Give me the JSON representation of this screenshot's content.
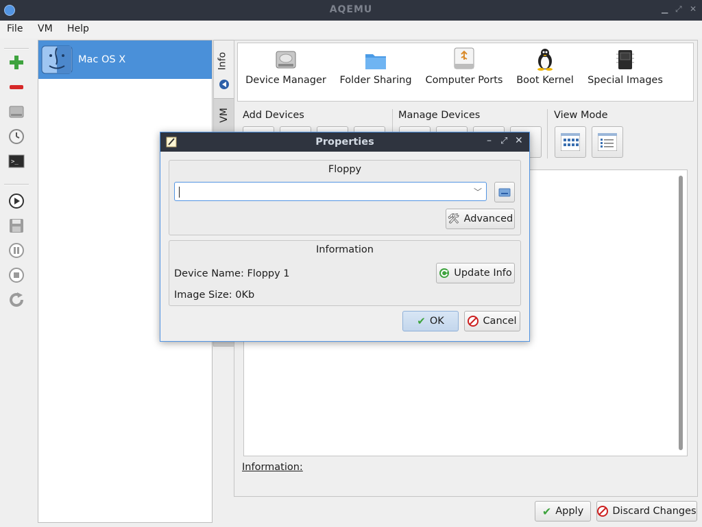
{
  "window": {
    "title": "AQEMU"
  },
  "menu": [
    "File",
    "VM",
    "Help"
  ],
  "vm_list": {
    "items": [
      {
        "name": "Mac OS X"
      }
    ]
  },
  "tabs": {
    "info": "Info",
    "vm": "VM"
  },
  "top_buttons": [
    "Device Manager",
    "Folder Sharing",
    "Computer Ports",
    "Boot Kernel",
    "Special Images"
  ],
  "groups": {
    "add_devices": "Add Devices",
    "manage_devices": "Manage Devices",
    "view_mode": "View Mode"
  },
  "information_label": "Information:",
  "footer": {
    "apply": "Apply",
    "discard": "Discard Changes"
  },
  "dialog": {
    "title": "Properties",
    "floppy_group": "Floppy",
    "floppy_value": "",
    "advanced": "Advanced",
    "info_group": "Information",
    "device_name": "Device Name: Floppy 1",
    "image_size": "Image Size: 0Kb",
    "update_info": "Update Info",
    "ok": "OK",
    "cancel": "Cancel"
  },
  "colors": {
    "accent": "#5294e2",
    "titlebar": "#2f343f",
    "selection": "#4a90d9"
  }
}
